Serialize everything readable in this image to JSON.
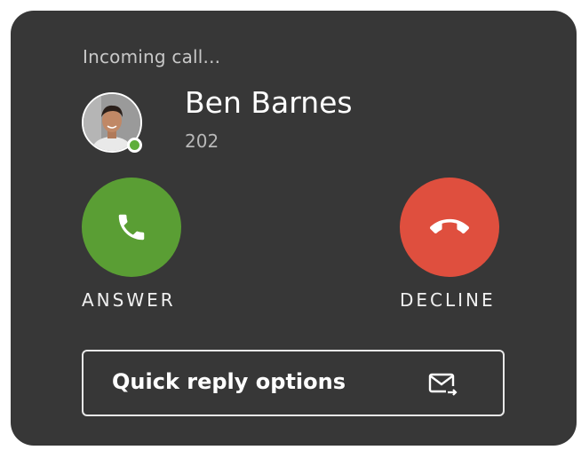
{
  "call": {
    "status": "Incoming call...",
    "caller_name": "Ben Barnes",
    "caller_ext": "202",
    "presence": "online"
  },
  "actions": {
    "answer_label": "ANSWER",
    "decline_label": "DECLINE",
    "quick_reply_label": "Quick reply options"
  },
  "colors": {
    "card_bg": "#373737",
    "answer": "#5a9e34",
    "decline": "#df4f3e",
    "presence_online": "#5fae3a"
  },
  "icons": {
    "answer": "phone-icon",
    "decline": "hang-up-icon",
    "quick_reply": "mail-reply-icon"
  }
}
